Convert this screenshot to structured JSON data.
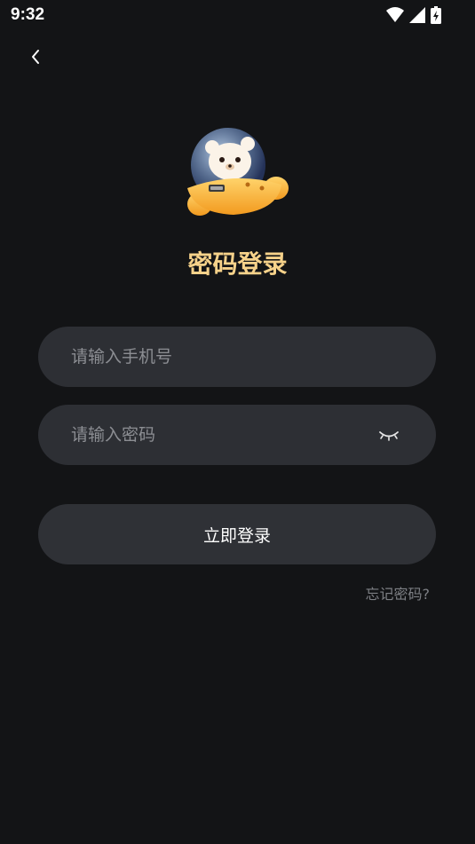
{
  "status_bar": {
    "time": "9:32"
  },
  "header": {
    "back_icon": "chevron-left-icon"
  },
  "login": {
    "title": "密码登录",
    "title_color": "#f6d28a",
    "phone_placeholder": "请输入手机号",
    "phone_value": "",
    "password_placeholder": "请输入密码",
    "password_value": "",
    "password_toggle_icon": "eye-closed-icon",
    "submit_label": "立即登录",
    "forgot_label": "忘记密码?"
  },
  "theme": {
    "background": "#131416",
    "field_background": "#2d2f34",
    "placeholder_color": "#8c8e93"
  }
}
